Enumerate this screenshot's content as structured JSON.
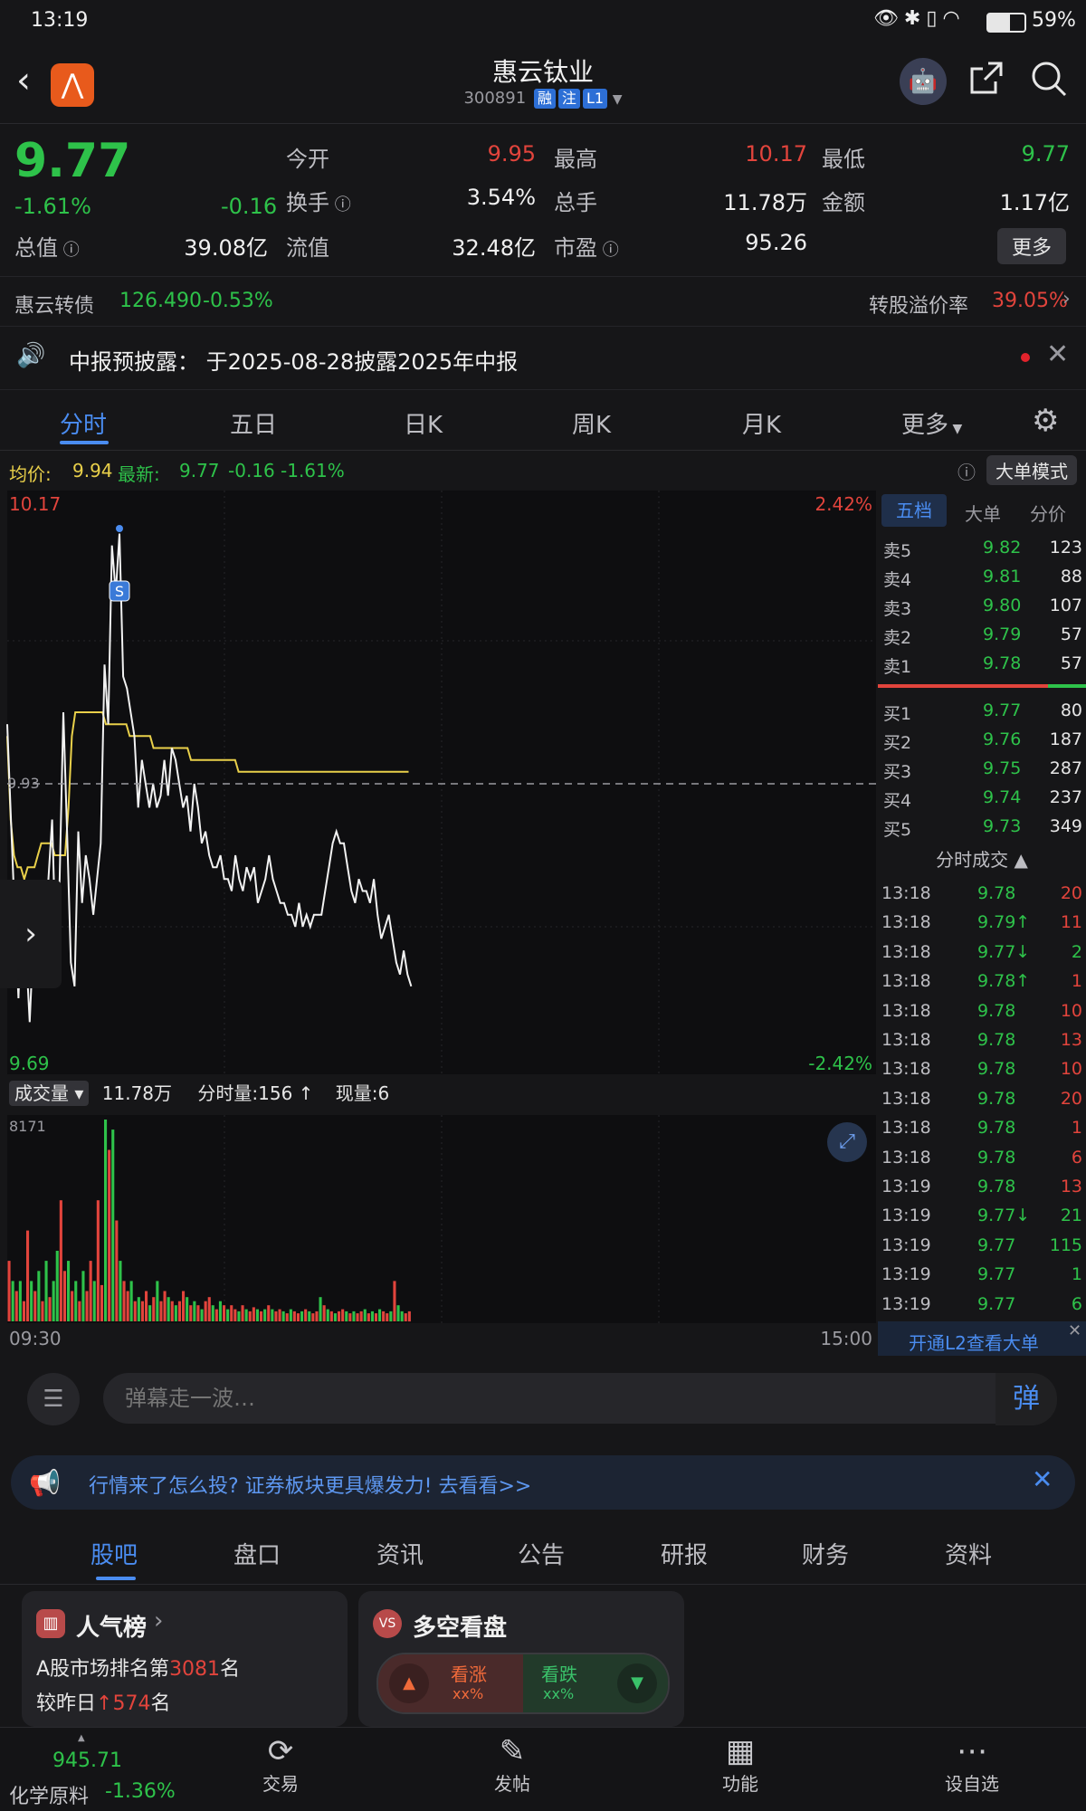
{
  "status": {
    "time": "13:19",
    "battery": "59%"
  },
  "header": {
    "title": "惠云钛业",
    "code": "300891",
    "tags": [
      "融",
      "注",
      "L1"
    ]
  },
  "quote": {
    "price": "9.77",
    "change_pct": "-1.61%",
    "change": "-0.16",
    "fields": [
      {
        "label": "今开",
        "value": "9.95",
        "color": "red"
      },
      {
        "label": "最高",
        "value": "10.17",
        "color": "red"
      },
      {
        "label": "最低",
        "value": "9.77",
        "color": "green"
      },
      {
        "label": "换手",
        "value": "3.54%",
        "color": "white"
      },
      {
        "label": "总手",
        "value": "11.78万",
        "color": "white"
      },
      {
        "label": "金额",
        "value": "1.17亿",
        "color": "white"
      },
      {
        "label": "总值",
        "value": "39.08亿",
        "color": "white"
      },
      {
        "label": "流值",
        "value": "32.48亿",
        "color": "white"
      },
      {
        "label": "市盈",
        "value": "95.26",
        "color": "white"
      }
    ],
    "more_label": "更多"
  },
  "bond": {
    "name": "惠云转债",
    "price": "126.490",
    "change": "-0.53%",
    "premium_label": "转股溢价率",
    "premium": "39.05%"
  },
  "notice": {
    "text": "中报预披露： 于2025-08-28披露2025年中报"
  },
  "tabs": [
    "分时",
    "五日",
    "日K",
    "周K",
    "月K",
    "更多"
  ],
  "chart_info": {
    "avg_label": "均价:",
    "avg": "9.94",
    "latest_label": "最新:",
    "latest": "9.77",
    "chg": "-0.16",
    "chg_pct": "-1.61%",
    "mode_btn": "大单模式"
  },
  "chart_data": {
    "type": "line",
    "x_start": "09:30",
    "x_end": "15:00",
    "y_top": "10.17",
    "y_bottom": "9.69",
    "pct_top": "2.42%",
    "pct_bottom": "-2.42%",
    "prev_close": "9.93",
    "ylim": [
      9.69,
      10.17
    ],
    "price": [
      9.98,
      9.9,
      9.82,
      9.75,
      9.84,
      9.79,
      9.73,
      9.8,
      9.77,
      9.83,
      9.8,
      9.85,
      9.9,
      9.79,
      9.85,
      9.99,
      9.89,
      9.78,
      9.76,
      9.89,
      9.83,
      9.87,
      9.85,
      9.82,
      9.85,
      9.88,
      10.03,
      9.98,
      10.13,
      10.09,
      10.14,
      10.02,
      10.01,
      9.99,
      9.97,
      9.91,
      9.95,
      9.93,
      9.91,
      9.93,
      9.91,
      9.92,
      9.95,
      9.92,
      9.96,
      9.95,
      9.93,
      9.91,
      9.92,
      9.89,
      9.93,
      9.91,
      9.88,
      9.89,
      9.87,
      9.86,
      9.86,
      9.87,
      9.85,
      9.85,
      9.84,
      9.87,
      9.85,
      9.84,
      9.86,
      9.85,
      9.86,
      9.83,
      9.84,
      9.85,
      9.87,
      9.85,
      9.84,
      9.83,
      9.83,
      9.82,
      9.82,
      9.81,
      9.83,
      9.81,
      9.82,
      9.81,
      9.82,
      9.82,
      9.82,
      9.84,
      9.86,
      9.88,
      9.89,
      9.88,
      9.88,
      9.86,
      9.84,
      9.83,
      9.85,
      9.84,
      9.84,
      9.83,
      9.85,
      9.82,
      9.8,
      9.81,
      9.82,
      9.8,
      9.78,
      9.77,
      9.79,
      9.77,
      9.76
    ],
    "avg": [
      9.97,
      9.9,
      9.87,
      9.86,
      9.86,
      9.85,
      9.86,
      9.86,
      9.86,
      9.87,
      9.88,
      9.88,
      9.88,
      9.88,
      9.87,
      9.87,
      9.87,
      9.87,
      9.91,
      9.97,
      9.99,
      9.99,
      9.99,
      9.99,
      9.99,
      9.99,
      9.99,
      9.99,
      9.99,
      9.98,
      9.98,
      9.98,
      9.98,
      9.98,
      9.98,
      9.98,
      9.97,
      9.97,
      9.97,
      9.97,
      9.97,
      9.97,
      9.97,
      9.96,
      9.96,
      9.96,
      9.96,
      9.96,
      9.96,
      9.96,
      9.96,
      9.96,
      9.96,
      9.96,
      9.95,
      9.95,
      9.95,
      9.95,
      9.95,
      9.95,
      9.95,
      9.95,
      9.95,
      9.95,
      9.95,
      9.95,
      9.95,
      9.95,
      9.94,
      9.94,
      9.94,
      9.94,
      9.94,
      9.94,
      9.94,
      9.94,
      9.94,
      9.94,
      9.94,
      9.94,
      9.94,
      9.94,
      9.94,
      9.94,
      9.94,
      9.94,
      9.94,
      9.94,
      9.94,
      9.94,
      9.94,
      9.94,
      9.94,
      9.94,
      9.94,
      9.94,
      9.94,
      9.94,
      9.94,
      9.94,
      9.94,
      9.94,
      9.94,
      9.94,
      9.94,
      9.94,
      9.94,
      9.94,
      9.94,
      9.94,
      9.94,
      9.94,
      9.94,
      9.94,
      9.94,
      9.94,
      9.94,
      9.94,
      9.94
    ],
    "volume": [
      0.3,
      0.2,
      0.15,
      0.2,
      0.1,
      0.45,
      0.2,
      0.15,
      0.25,
      0.1,
      0.3,
      0.12,
      0.2,
      0.35,
      0.6,
      0.25,
      0.3,
      0.15,
      0.2,
      0.1,
      0.25,
      0.15,
      0.3,
      0.2,
      0.6,
      0.18,
      1.0,
      0.85,
      0.95,
      0.5,
      0.3,
      0.2,
      0.15,
      0.2,
      0.1,
      0.12,
      0.1,
      0.15,
      0.08,
      0.12,
      0.2,
      0.1,
      0.15,
      0.12,
      0.1,
      0.08,
      0.1,
      0.15,
      0.12,
      0.08,
      0.1,
      0.08,
      0.06,
      0.1,
      0.12,
      0.08,
      0.06,
      0.1,
      0.08,
      0.06,
      0.08,
      0.06,
      0.05,
      0.08,
      0.06,
      0.05,
      0.07,
      0.06,
      0.05,
      0.06,
      0.08,
      0.06,
      0.05,
      0.06,
      0.05,
      0.04,
      0.06,
      0.05,
      0.04,
      0.05,
      0.06,
      0.05,
      0.04,
      0.05,
      0.12,
      0.08,
      0.06,
      0.05,
      0.04,
      0.05,
      0.06,
      0.05,
      0.04,
      0.05,
      0.04,
      0.05,
      0.06,
      0.04,
      0.05,
      0.04,
      0.06,
      0.05,
      0.04,
      0.05,
      0.2,
      0.08,
      0.05,
      0.04,
      0.05
    ],
    "volume_colors": "rgrgrrgrgrgrggrrgrgrgrrgrrgrgrgrrgrgrrgrgrrgrgrrgrgrgrrgrgrgrrgrgrrgrgrgrrgrgrrgrgrrgrgrgrrgrgrrgrgrgrrgrgg",
    "vol_max_label": "8171",
    "vol_total_label": "11.78万",
    "vol_tick_label": "分时量:156",
    "vol_now_label": "现量:6"
  },
  "orderbook": {
    "tabs": [
      "五档",
      "大单",
      "分价"
    ],
    "asks": [
      {
        "label": "卖5",
        "price": "9.82",
        "vol": "123"
      },
      {
        "label": "卖4",
        "price": "9.81",
        "vol": "88"
      },
      {
        "label": "卖3",
        "price": "9.80",
        "vol": "107"
      },
      {
        "label": "卖2",
        "price": "9.79",
        "vol": "57"
      },
      {
        "label": "卖1",
        "price": "9.78",
        "vol": "57"
      }
    ],
    "bids": [
      {
        "label": "买1",
        "price": "9.77",
        "vol": "80"
      },
      {
        "label": "买2",
        "price": "9.76",
        "vol": "187"
      },
      {
        "label": "买3",
        "price": "9.75",
        "vol": "287"
      },
      {
        "label": "买4",
        "price": "9.74",
        "vol": "237"
      },
      {
        "label": "买5",
        "price": "9.73",
        "vol": "349"
      }
    ],
    "ticks_title": "分时成交",
    "ticks": [
      {
        "t": "13:18",
        "p": "9.78",
        "v": "20"
      },
      {
        "t": "13:18",
        "p": "9.79↑",
        "v": "11"
      },
      {
        "t": "13:18",
        "p": "9.77↓",
        "v": "2"
      },
      {
        "t": "13:18",
        "p": "9.78↑",
        "v": "1"
      },
      {
        "t": "13:18",
        "p": "9.78",
        "v": "10"
      },
      {
        "t": "13:18",
        "p": "9.78",
        "v": "13"
      },
      {
        "t": "13:18",
        "p": "9.78",
        "v": "10"
      },
      {
        "t": "13:18",
        "p": "9.78",
        "v": "20"
      },
      {
        "t": "13:18",
        "p": "9.78",
        "v": "1"
      },
      {
        "t": "13:18",
        "p": "9.78",
        "v": "6"
      },
      {
        "t": "13:19",
        "p": "9.78",
        "v": "13"
      },
      {
        "t": "13:19",
        "p": "9.77↓",
        "v": "21"
      },
      {
        "t": "13:19",
        "p": "9.77",
        "v": "115"
      },
      {
        "t": "13:19",
        "p": "9.77",
        "v": "1"
      },
      {
        "t": "13:19",
        "p": "9.77",
        "v": "6"
      }
    ],
    "l2_link": "开通L2查看大单"
  },
  "danmu": {
    "placeholder": "弹幕走一波…",
    "send": "弹"
  },
  "banner": {
    "text": "行情来了怎么投? 证券板块更具爆发力! 去看看>>"
  },
  "subtabs": [
    "股吧",
    "盘口",
    "资讯",
    "公告",
    "研报",
    "财务",
    "资料"
  ],
  "popularity": {
    "title": "人气榜",
    "line1_prefix": "A股市场排名第",
    "rank": "3081",
    "line1_suffix": "名",
    "line2_prefix": "较昨日",
    "delta": "574",
    "line2_suffix": "名"
  },
  "longshort": {
    "title": "多空看盘",
    "up_label": "看涨",
    "up_value": "xx%",
    "down_label": "看跌",
    "down_value": "xx%"
  },
  "bottom_nav": {
    "index_value": "945.71",
    "index_name": "化学原料",
    "index_change": "-1.36%",
    "items": [
      "交易",
      "发帖",
      "功能",
      "设自选"
    ]
  }
}
